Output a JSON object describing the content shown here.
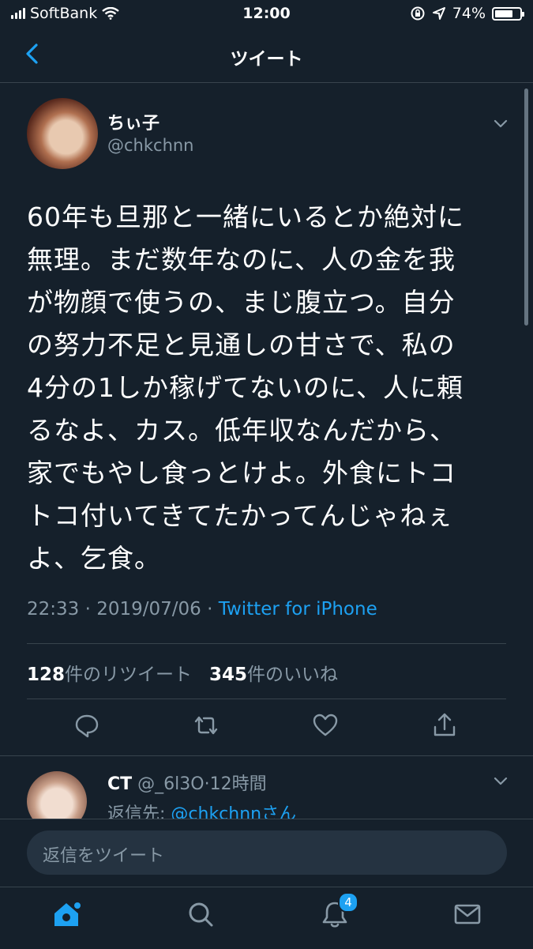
{
  "status_bar": {
    "carrier": "SoftBank",
    "time": "12:00",
    "battery_percent": "74%",
    "battery_level": 0.74
  },
  "header": {
    "title": "ツイート"
  },
  "tweet": {
    "author_name": "ちぃ子",
    "author_handle": "@chkchnn",
    "text": "60年も旦那と一緒にいるとか絶対に\n無理。まだ数年なのに、人の金を我\nが物顔で使うの、まじ腹立つ。自分\nの努力不足と見通しの甘さで、私の\n4分の1しか稼げてないのに、人に頼\nるなよ、カス。低年収なんだから、\n家でもやし食っとけよ。外食にトコ\nトコ付いてきてたかってんじゃねぇ\nよ、乞食。",
    "time": "22:33",
    "date": "2019/07/06",
    "separator": " · ",
    "source": "Twitter for iPhone",
    "retweet_count": "128",
    "retweet_label": "件のリツイート",
    "like_count": "345",
    "like_label": "件のいいね"
  },
  "reply": {
    "name": "CT",
    "handle": "@_6l3O",
    "age": "12時間",
    "separator": "·",
    "replying_prefix": "返信先: ",
    "replying_to": "@chkchnn",
    "replying_suffix": "さん"
  },
  "compose": {
    "placeholder": "返信をツイート"
  },
  "tab_bar": {
    "notifications_badge": "4"
  },
  "colors": {
    "background": "#15202b",
    "accent": "#1da1f2",
    "muted": "#8899a6",
    "divider": "#38444d"
  }
}
